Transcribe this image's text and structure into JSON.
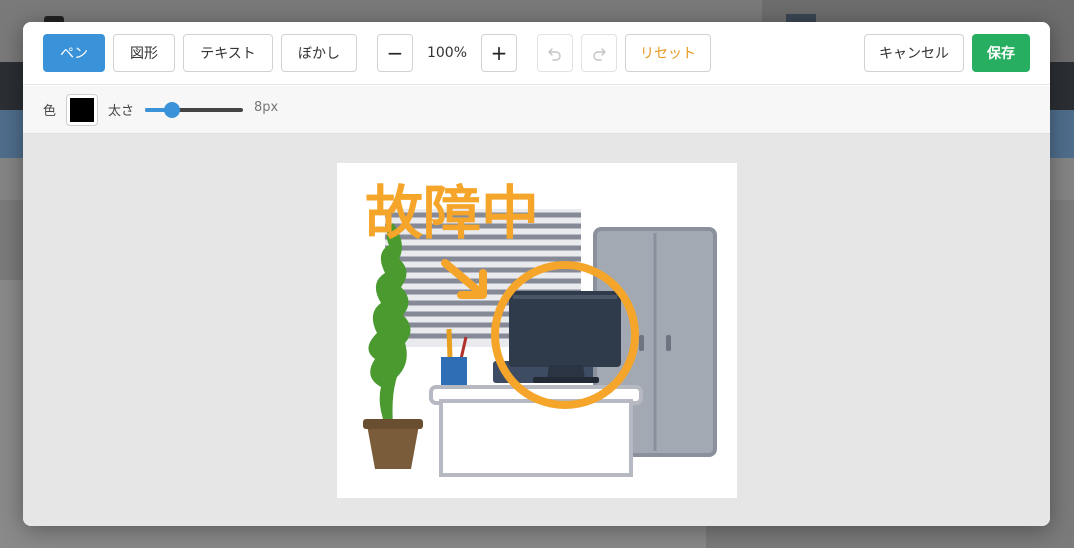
{
  "toolbar": {
    "tools": [
      "ペン",
      "図形",
      "テキスト",
      "ぼかし"
    ],
    "active_tool": "ペン",
    "zoom_out_label": "−",
    "zoom_value": "100%",
    "zoom_in_label": "+",
    "undo_icon": "undo-icon",
    "redo_icon": "redo-icon",
    "reset_label": "リセット",
    "cancel_label": "キャンセル",
    "save_label": "保存"
  },
  "options": {
    "color_label": "色",
    "color_value": "#000000",
    "width_label": "太さ",
    "width_value": "8px",
    "width_fraction": 0.28
  },
  "annotation": {
    "handwritten_text": "故障中",
    "stroke_color": "#f5a52a"
  },
  "colors": {
    "accent": "#3a93d9",
    "save": "#27ae60",
    "reset": "#e79a23"
  }
}
